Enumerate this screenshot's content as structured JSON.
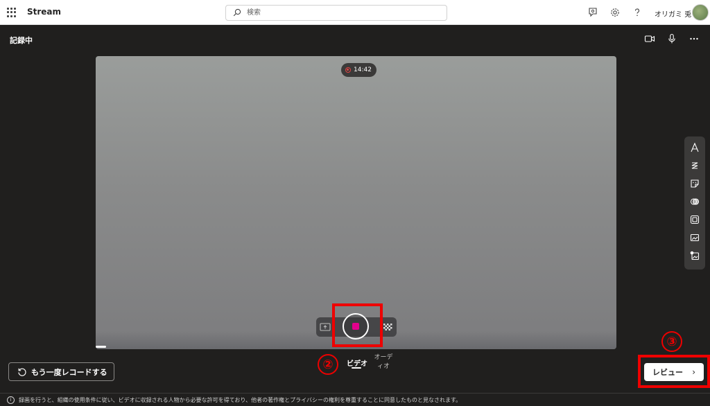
{
  "topbar": {
    "app_name": "Stream",
    "search_placeholder": "検索",
    "user_name": "オリガミ 兎"
  },
  "header": {
    "title": "記録中"
  },
  "preview": {
    "timer": "14:42",
    "progress_fraction": 0.02
  },
  "controls": {
    "mode_video": "ビデオ",
    "mode_audio": "オーディオ"
  },
  "annotations": {
    "step2": "②",
    "step3": "③"
  },
  "buttons": {
    "retake": "もう一度レコードする",
    "review": "レビュー"
  },
  "footer": {
    "notice": "録画を行うと、組織の使用条件に従い、ビデオに収録される人物から必要な許可を得ており、他者の著作権とプライバシーの権利を尊重することに同意したものと見なされます。"
  },
  "colors": {
    "stop": "#e3008c",
    "highlight": "#ee0000",
    "recording": "#e04343"
  },
  "icons": {
    "tools": [
      "text-icon",
      "pen-icon",
      "sticky-note-icon",
      "filter-icon",
      "frame-icon",
      "backdrop-icon",
      "image-icon"
    ]
  }
}
